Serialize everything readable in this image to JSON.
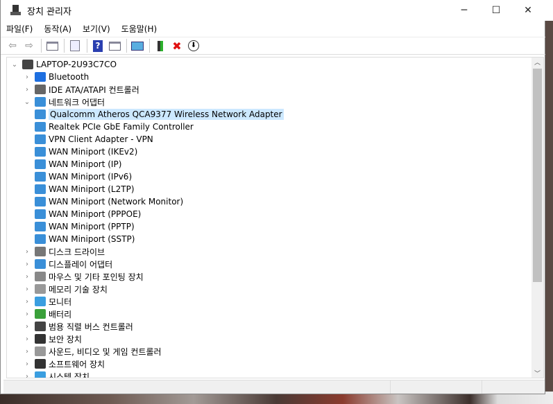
{
  "window": {
    "title": "장치 관리자",
    "minimize": "─",
    "maximize": "☐",
    "close": "✕"
  },
  "menu": [
    "파일(F)",
    "동작(A)",
    "보기(V)",
    "도움말(H)"
  ],
  "toolbar": [
    "back-icon",
    "forward-icon",
    "show-hide-console-tree-icon",
    "properties-icon",
    "help-icon",
    "action-pane-icon",
    "scan-hardware-icon",
    "update-driver-icon",
    "uninstall-icon",
    "disable-icon"
  ],
  "tree": {
    "root": "LAPTOP-2U93C7CO",
    "items": [
      {
        "label": "Bluetooth",
        "level": 1,
        "state": "collapsed",
        "color": "#1e6fe0"
      },
      {
        "label": "IDE ATA/ATAPI 컨트롤러",
        "level": 1,
        "state": "collapsed",
        "color": "#666666"
      },
      {
        "label": "네트워크 어댑터",
        "level": 1,
        "state": "expanded",
        "color": "#3a8fd8"
      },
      {
        "label": "Qualcomm Atheros QCA9377 Wireless Network Adapter",
        "level": 2,
        "selected": true,
        "color": "#3a8fd8"
      },
      {
        "label": "Realtek PCIe GbE Family Controller",
        "level": 2,
        "color": "#3a8fd8"
      },
      {
        "label": "VPN Client Adapter - VPN",
        "level": 2,
        "color": "#3a8fd8"
      },
      {
        "label": "WAN Miniport (IKEv2)",
        "level": 2,
        "color": "#3a8fd8"
      },
      {
        "label": "WAN Miniport (IP)",
        "level": 2,
        "color": "#3a8fd8"
      },
      {
        "label": "WAN Miniport (IPv6)",
        "level": 2,
        "color": "#3a8fd8"
      },
      {
        "label": "WAN Miniport (L2TP)",
        "level": 2,
        "color": "#3a8fd8"
      },
      {
        "label": "WAN Miniport (Network Monitor)",
        "level": 2,
        "color": "#3a8fd8"
      },
      {
        "label": "WAN Miniport (PPPOE)",
        "level": 2,
        "color": "#3a8fd8"
      },
      {
        "label": "WAN Miniport (PPTP)",
        "level": 2,
        "color": "#3a8fd8"
      },
      {
        "label": "WAN Miniport (SSTP)",
        "level": 2,
        "color": "#3a8fd8"
      },
      {
        "label": "디스크 드라이브",
        "level": 1,
        "state": "collapsed",
        "color": "#777777"
      },
      {
        "label": "디스플레이 어댑터",
        "level": 1,
        "state": "collapsed",
        "color": "#3a8fd8"
      },
      {
        "label": "마우스 및 기타 포인팅 장치",
        "level": 1,
        "state": "collapsed",
        "color": "#888888"
      },
      {
        "label": "메모리 기술 장치",
        "level": 1,
        "state": "collapsed",
        "color": "#999999"
      },
      {
        "label": "모니터",
        "level": 1,
        "state": "collapsed",
        "color": "#3a9ee0"
      },
      {
        "label": "배터리",
        "level": 1,
        "state": "collapsed",
        "color": "#3aa03a"
      },
      {
        "label": "범용 직렬 버스 컨트롤러",
        "level": 1,
        "state": "collapsed",
        "color": "#444444"
      },
      {
        "label": "보안 장치",
        "level": 1,
        "state": "collapsed",
        "color": "#333333"
      },
      {
        "label": "사운드, 비디오 및 게임 컨트롤러",
        "level": 1,
        "state": "collapsed",
        "color": "#999999"
      },
      {
        "label": "소프트웨어 장치",
        "level": 1,
        "state": "collapsed",
        "color": "#333333"
      },
      {
        "label": "시스템 장치",
        "level": 1,
        "state": "collapsed",
        "color": "#3a9ee0"
      }
    ]
  }
}
